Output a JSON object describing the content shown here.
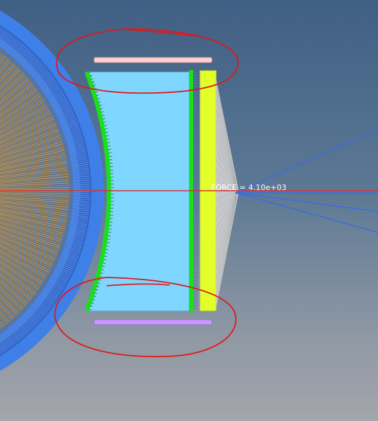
{
  "force_readout": "FORCE = 4.10e+03",
  "colors": {
    "background_top": "#3f5f84",
    "background_bottom": "#a3a6ab",
    "outer_ring": "#3f7fe8",
    "spokes": "#f0a020",
    "pad_fill": "#7fd6ff",
    "contact_edge": "#19e019",
    "backing_plate": "#e2ff2a",
    "top_clip": "#ffd0d0",
    "bottom_clip": "#c79aff",
    "force_ray": "#3a6ce0",
    "axis_line": "#d83030",
    "annotation": "#e01818",
    "load_fan": "#d0d0d0"
  },
  "icons": {
    "force_arrow": "load-fan-icon"
  }
}
